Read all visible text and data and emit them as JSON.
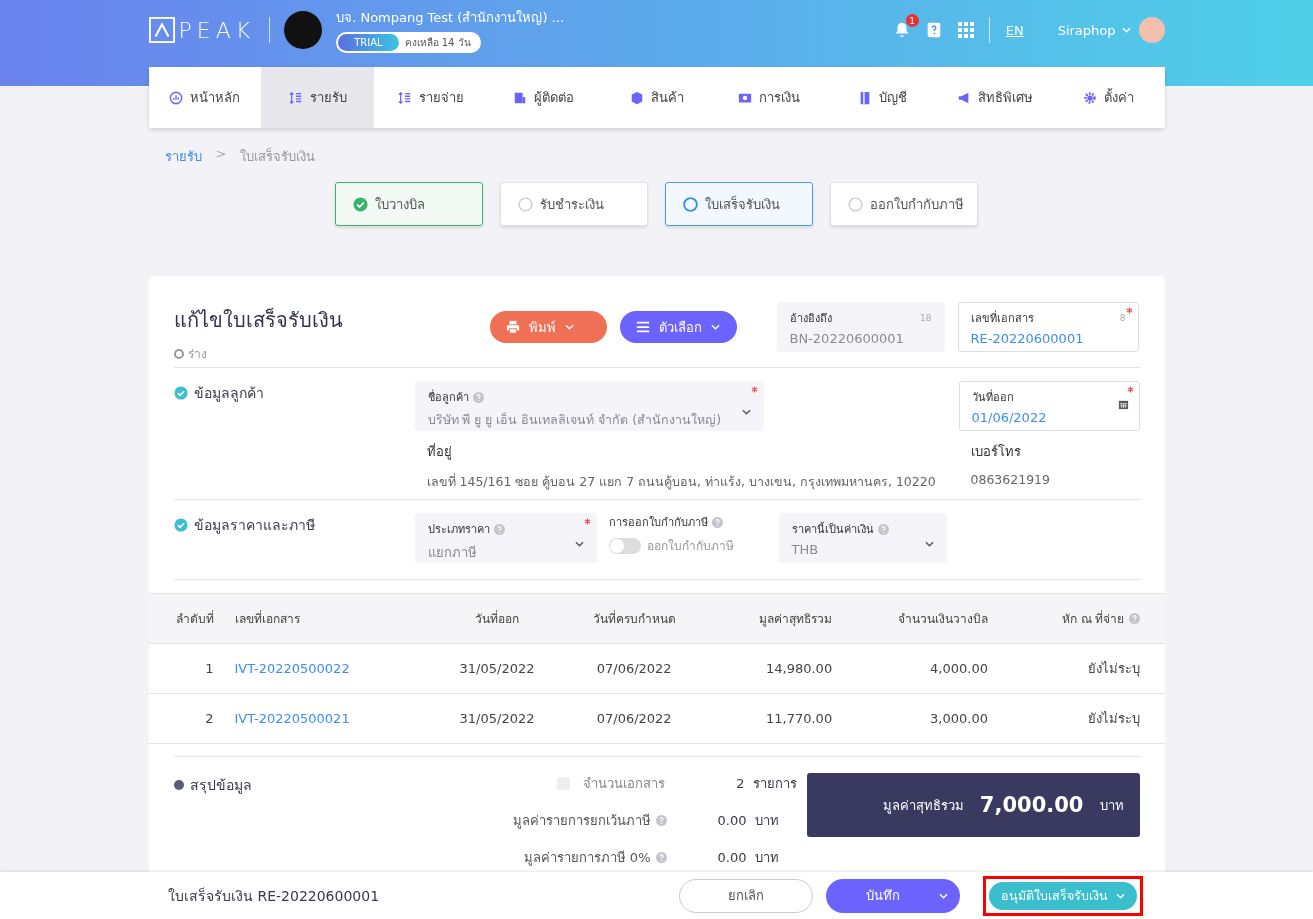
{
  "header": {
    "logo": "PEAK",
    "company": "บจ. Nompang Test (สำนักงานใหญ่) ...",
    "trial_badge": "TRIAL",
    "trial_remaining": "คงเหลือ 14 วัน",
    "notification_count": "1",
    "language": "EN",
    "user": "Siraphop"
  },
  "nav": [
    {
      "label": "หน้าหลัก",
      "selected": false
    },
    {
      "label": "รายรับ",
      "selected": true
    },
    {
      "label": "รายจ่าย",
      "selected": false
    },
    {
      "label": "ผู้ติดต่อ",
      "selected": false
    },
    {
      "label": "สินค้า",
      "selected": false
    },
    {
      "label": "การเงิน",
      "selected": false
    },
    {
      "label": "บัญชี",
      "selected": false
    },
    {
      "label": "สิทธิพิเศษ",
      "selected": false
    },
    {
      "label": "ตั้งค่า",
      "selected": false
    }
  ],
  "breadcrumb": {
    "items": [
      "รายรับ",
      "ใบเสร็จรับเงิน"
    ],
    "separator": ">"
  },
  "steps": [
    {
      "label": "ใบวางบิล",
      "completed": true,
      "selected": false
    },
    {
      "label": "รับชำระเงิน",
      "completed": false,
      "selected": false
    },
    {
      "label": "ใบเสร็จรับเงิน",
      "completed": false,
      "selected": true
    },
    {
      "label": "ออกใบกำกับภาษี",
      "completed": false,
      "selected": false
    }
  ],
  "document": {
    "title": "แก้ไขใบเสร็จรับเงิน",
    "status": "ร่าง",
    "print_button": "พิมพ์",
    "options_button": "ตัวเลือก",
    "reference": {
      "label": "อ้างอิงถึง",
      "counter": "18",
      "value": "BN-20220600001"
    },
    "doc_number": {
      "label": "เลขที่เอกสาร",
      "counter": "8",
      "value": "RE-20220600001",
      "required": true
    }
  },
  "customer_section": {
    "title": "ข้อมูลลูกค้า",
    "checked": true,
    "customer": {
      "label": "ชื่อลูกค้า",
      "value": "บริษัท พี ยู ยู เอ็น อินเทลลิเจนท์ จำกัด (สำนักงานใหญ่)",
      "required": true
    },
    "issue_date": {
      "label": "วันที่ออก",
      "value": "01/06/2022",
      "required": true
    },
    "address": {
      "label": "ที่อยู่",
      "value": "เลขที่ 145/161 ซอย คู้บอน 27 แยก 7 ถนนคู้บอน, ท่าแร้ง, บางเขน, กรุงเทพมหานคร, 10220"
    },
    "phone": {
      "label": "เบอร์โทร",
      "value": "0863621919"
    }
  },
  "pricing_section": {
    "title": "ข้อมูลราคาและภาษี",
    "checked": true,
    "price_type": {
      "label": "ประเภทราคา",
      "value": "แยกภาษี",
      "required": true
    },
    "tax_invoice": {
      "label": "การออกใบกำกับภาษี",
      "toggle_label": "ออกใบกำกับภาษี",
      "on": false
    },
    "currency": {
      "label": "ราคานี้เป็นค่าเงิน",
      "value": "THB"
    }
  },
  "table": {
    "columns": [
      "ลำดับที่",
      "เลขที่เอกสาร",
      "วันที่ออก",
      "วันที่ครบกำหนด",
      "มูลค่าสุทธิรวม",
      "จำนวนเงินวางบิล",
      "หัก ณ ที่จ่าย"
    ],
    "rows": [
      [
        "1",
        "IVT-20220500022",
        "31/05/2022",
        "07/06/2022",
        "14,980.00",
        "4,000.00",
        "ยังไม่ระบุ"
      ],
      [
        "2",
        "IVT-20220500021",
        "31/05/2022",
        "07/06/2022",
        "11,770.00",
        "3,000.00",
        "ยังไม่ระบุ"
      ]
    ]
  },
  "summary": {
    "title": "สรุปข้อมูล",
    "rows": [
      {
        "label": "จำนวนเอกสาร",
        "value": "2",
        "unit": "รายการ",
        "kind": "checkbox",
        "checked": false
      },
      {
        "label": "มูลค่ารายการยกเว้นภาษี",
        "value": "0.00",
        "unit": "บาท",
        "kind": "help"
      },
      {
        "label": "มูลค่ารายการภาษี 0%",
        "value": "0.00",
        "unit": "บาท",
        "kind": "help"
      }
    ],
    "total": {
      "label": "มูลค่าสุทธิรวม",
      "value": "7,000.00",
      "unit": "บาท"
    }
  },
  "footer": {
    "document": "ใบเสร็จรับเงิน RE-20220600001",
    "cancel": "ยกเลิก",
    "save": "บันทึก",
    "approve": "อนุมัติใบเสร็จรับเงิน",
    "approve_highlighted": true
  }
}
